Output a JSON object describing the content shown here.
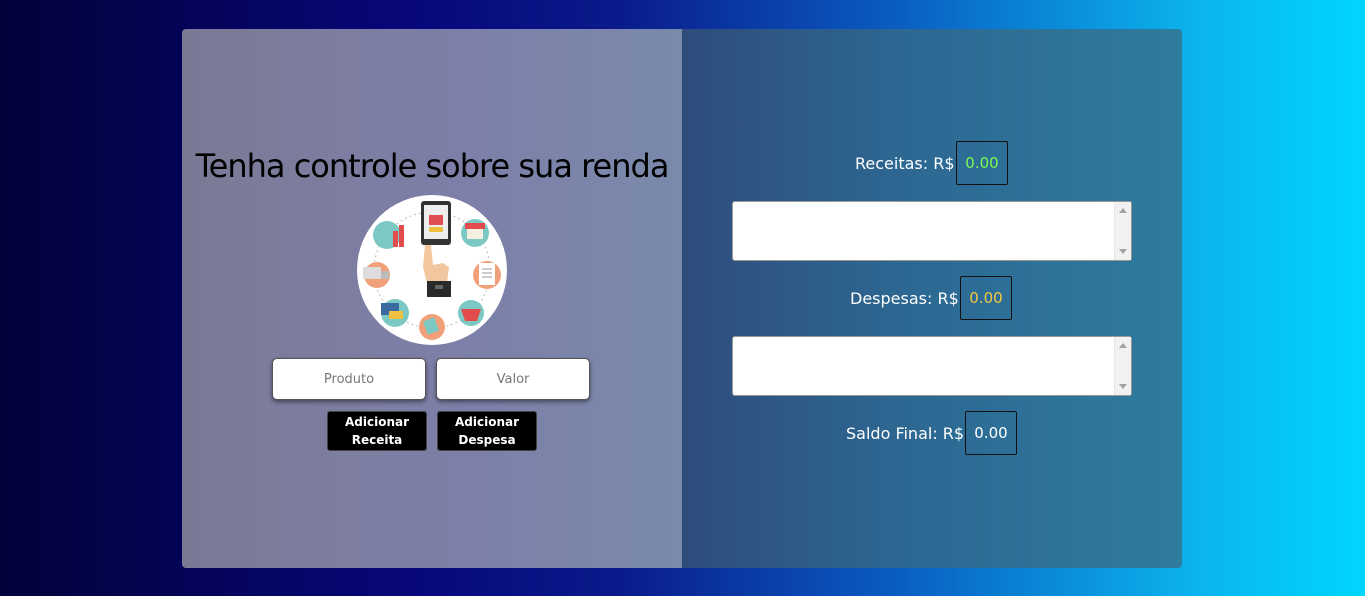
{
  "left": {
    "title": "Tenha controle sobre sua renda",
    "product_placeholder": "Produto",
    "value_placeholder": "Valor",
    "add_income_label": "Adicionar Receita",
    "add_expense_label": "Adicionar Despesa",
    "logo_icon": "shopping-circle-illustration-icon"
  },
  "right": {
    "income_label": "Receitas: R$",
    "income_value": "0.00",
    "expense_label": "Despesas: R$",
    "expense_value": "0.00",
    "balance_label": "Saldo Final: R$",
    "balance_value": "0.00"
  },
  "colors": {
    "income": "#7CFC50",
    "expense": "#F5C842",
    "balance": "#ffffff"
  }
}
